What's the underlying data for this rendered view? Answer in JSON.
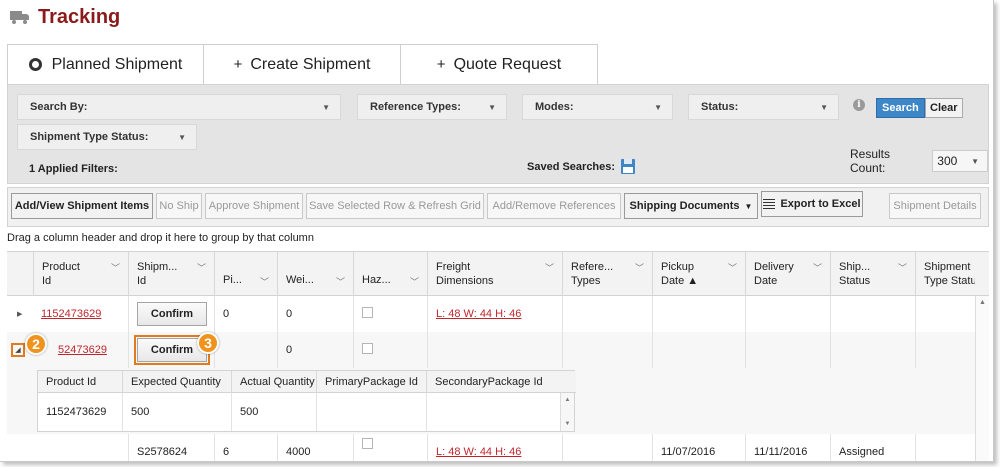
{
  "header": {
    "title": "Tracking",
    "icon": "truck-icon"
  },
  "tabs": [
    {
      "label": "Planned Shipment",
      "icon": "radio-icon"
    },
    {
      "label": "Create Shipment",
      "icon": "plus-icon",
      "symbol": "+"
    },
    {
      "label": "Quote Request",
      "icon": "plus-icon",
      "symbol": "+"
    }
  ],
  "filters": {
    "search_by": "Search By:",
    "reference_types": "Reference Types:",
    "modes": "Modes:",
    "status": "Status:",
    "shipment_type_status": "Shipment Type Status:",
    "applied_filters": "1 Applied Filters:",
    "saved_searches": "Saved Searches:",
    "search_label": "Search",
    "clear_label": "Clear",
    "results_count_label": "Results Count:",
    "results_count_value": "300",
    "info_symbol": "i"
  },
  "toolbar": {
    "add_view": "Add/View Shipment Items",
    "no_ship": "No Ship",
    "approve": "Approve Shipment",
    "save_refresh": "Save Selected Row & Refresh Grid",
    "add_remove_refs": "Add/Remove References",
    "shipping_docs": "Shipping Documents",
    "export_excel": "Export to Excel",
    "shipment_details": "Shipment Details"
  },
  "group_hint": "Drag a column header and drop it here to group by that column",
  "grid": {
    "columns": [
      {
        "l1": "Product",
        "l2": "Id"
      },
      {
        "l1": "Shipm...",
        "l2": "Id"
      },
      {
        "l1": "Pi..."
      },
      {
        "l1": "Wei..."
      },
      {
        "l1": "Haz..."
      },
      {
        "l1": "Freight",
        "l2": "Dimensions"
      },
      {
        "l1": "Refere...",
        "l2": "Types"
      },
      {
        "l1": "Pickup",
        "l2": "Date ▲"
      },
      {
        "l1": "Delivery",
        "l2": "Date"
      },
      {
        "l1": "Ship...",
        "l2": "Status"
      },
      {
        "l1": "Shipment",
        "l2": "Type Statu"
      }
    ],
    "rows": [
      {
        "product_id": "1152473629",
        "action": "Confirm",
        "pieces": "0",
        "weight": "0",
        "freight": "L: 48 W: 44 H: 46"
      },
      {
        "product_id": "52473629",
        "action": "Confirm",
        "weight": "0"
      },
      {
        "shipment_id": "S2578624",
        "pieces": "6",
        "weight": "4000",
        "freight": "L: 48 W: 44 H: 46",
        "pickup": "11/07/2016",
        "delivery": "11/11/2016",
        "status": "Assigned"
      }
    ]
  },
  "subgrid": {
    "columns": [
      "Product Id",
      "Expected Quantity",
      "Actual Quantity",
      "PrimaryPackage Id",
      "SecondaryPackage Id"
    ],
    "row": {
      "product_id": "1152473629",
      "expected": "500",
      "actual": "500"
    }
  },
  "callouts": {
    "b2": "2",
    "b3": "3"
  },
  "colors": {
    "title": "#8b1a1a",
    "link": "#c0272d",
    "search_button": "#3d86c8",
    "highlight": "#e07b20",
    "badge": "#f0921e"
  }
}
